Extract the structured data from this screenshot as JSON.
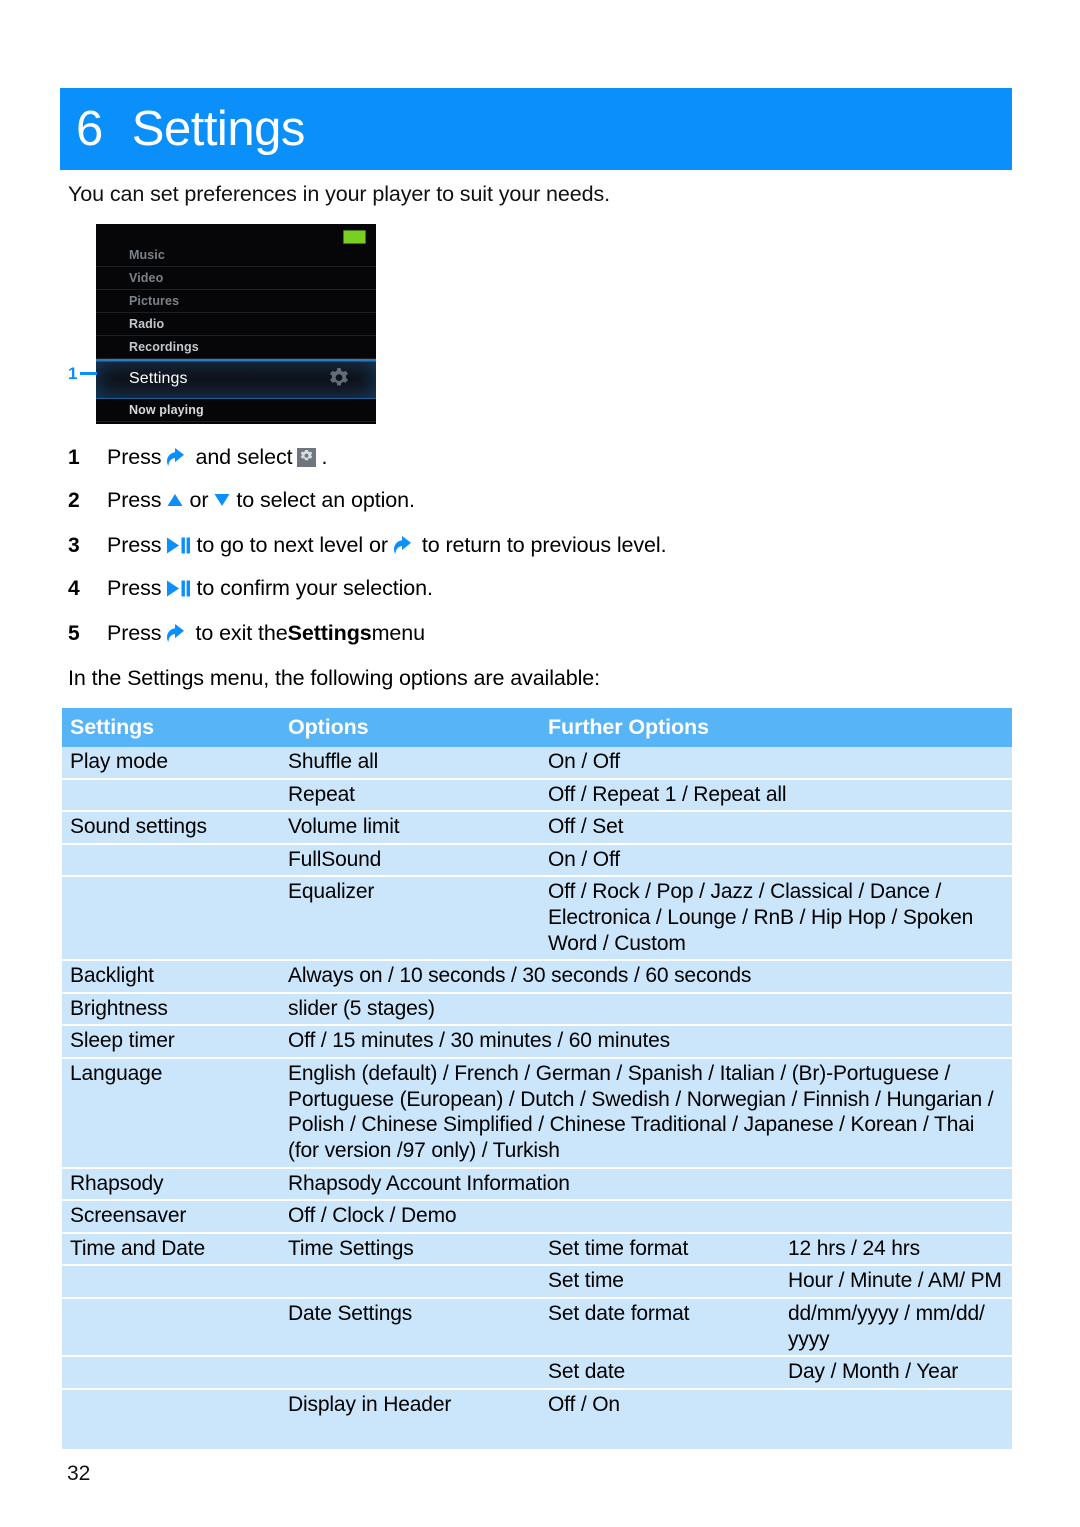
{
  "chapter": {
    "number": "6",
    "title": "Settings"
  },
  "intro": "You can set preferences in your player to suit your needs.",
  "device": {
    "callout_number": "1",
    "menu_items": [
      {
        "label": "Music"
      },
      {
        "label": "Video"
      },
      {
        "label": "Pictures"
      },
      {
        "label": "Radio"
      },
      {
        "label": "Recordings"
      },
      {
        "label": "Settings"
      },
      {
        "label": "Now playing"
      }
    ],
    "selected_item": "Settings",
    "selected_icon": "gear-icon",
    "battery_icon": "battery-full-icon"
  },
  "steps": [
    {
      "number": "1",
      "parts": [
        {
          "type": "text",
          "value": "Press "
        },
        {
          "type": "icon",
          "value": "back-arrow-icon"
        },
        {
          "type": "text",
          "value": " and select "
        },
        {
          "type": "icon",
          "value": "gear-square-icon"
        },
        {
          "type": "text",
          "value": "."
        }
      ],
      "plain": "Press [back] and select [settings]."
    },
    {
      "number": "2",
      "parts": [
        {
          "type": "text",
          "value": "Press "
        },
        {
          "type": "icon",
          "value": "triangle-up-icon"
        },
        {
          "type": "text",
          "value": " or "
        },
        {
          "type": "icon",
          "value": "triangle-down-icon"
        },
        {
          "type": "text",
          "value": " to select an option."
        }
      ],
      "plain": "Press [up] or [down] to select an option."
    },
    {
      "number": "3",
      "parts": [
        {
          "type": "text",
          "value": "Press "
        },
        {
          "type": "icon",
          "value": "play-pause-icon"
        },
        {
          "type": "text",
          "value": " to go to next level or "
        },
        {
          "type": "icon",
          "value": "back-arrow-icon"
        },
        {
          "type": "text",
          "value": " to return to previous level."
        }
      ],
      "plain": "Press [play/pause] to go to next level or [back] to return to previous level."
    },
    {
      "number": "4",
      "parts": [
        {
          "type": "text",
          "value": "Press "
        },
        {
          "type": "icon",
          "value": "play-pause-icon"
        },
        {
          "type": "text",
          "value": " to confirm your selection."
        }
      ],
      "plain": "Press [play/pause] to confirm your selection."
    },
    {
      "number": "5",
      "parts": [
        {
          "type": "text",
          "value": "Press "
        },
        {
          "type": "icon",
          "value": "back-arrow-icon"
        },
        {
          "type": "text",
          "value": " to exit the "
        },
        {
          "type": "bold",
          "value": "Settings"
        },
        {
          "type": "text",
          "value": " menu"
        }
      ],
      "plain": "Press [back] to exit the Settings menu"
    }
  ],
  "availability_text": "In the Settings menu, the following options are available:",
  "table": {
    "headers": [
      "Settings",
      "Options",
      "Further Options"
    ],
    "rows": [
      {
        "c1": "Play mode",
        "c2": "Shuffle all",
        "c3": "On / Off",
        "c4": ""
      },
      {
        "c1": "",
        "c2": "Repeat",
        "c3": "Off / Repeat 1 / Repeat all",
        "c4": ""
      },
      {
        "c1": "Sound settings",
        "c2": "Volume limit",
        "c3": "Off / Set",
        "c4": ""
      },
      {
        "c1": "",
        "c2": "FullSound",
        "c3": "On / Off",
        "c4": ""
      },
      {
        "c1": "",
        "c2": "Equalizer",
        "c3": "Off / Rock / Pop / Jazz / Classical / Dance / Electronica / Lounge / RnB / Hip Hop / Spoken Word / Custom",
        "c4": ""
      },
      {
        "c1": "Backlight",
        "c2": "Always on / 10 seconds / 30 seconds / 60 seconds",
        "c3": "",
        "c4": "",
        "span2": true
      },
      {
        "c1": "Brightness",
        "c2": "slider (5 stages)",
        "c3": "",
        "c4": "",
        "span2": true
      },
      {
        "c1": "Sleep timer",
        "c2": "Off / 15 minutes / 30 minutes / 60 minutes",
        "c3": "",
        "c4": "",
        "span2": true
      },
      {
        "c1": "Language",
        "c2": "English (default) / French / German / Spanish / Italian / (Br)-Portuguese / Portuguese (European) / Dutch / Swedish / Norwegian / Finnish / Hungarian / Polish / Chinese Simplified / Chinese Traditional / Japanese / Korean / Thai (for version /97 only) / Turkish",
        "c3": "",
        "c4": "",
        "span2": true
      },
      {
        "c1": "Rhapsody",
        "c2": "Rhapsody Account Information",
        "c3": "",
        "c4": "",
        "span2": true
      },
      {
        "c1": "Screensaver",
        "c2": "Off / Clock / Demo",
        "c3": "",
        "c4": "",
        "span2": true
      },
      {
        "c1": "Time and Date",
        "c2": "Time Settings",
        "c3": "Set time format",
        "c4": "12 hrs / 24 hrs"
      },
      {
        "c1": "",
        "c2": "",
        "c3": "Set time",
        "c4": "Hour / Minute / AM/ PM"
      },
      {
        "c1": "",
        "c2": "Date Settings",
        "c3": "Set date format",
        "c4": "dd/mm/yyyy / mm/dd/ yyyy"
      },
      {
        "c1": "",
        "c2": "",
        "c3": "Set date",
        "c4": "Day / Month / Year"
      },
      {
        "c1": "",
        "c2": "Display in Header",
        "c3": "Off / On",
        "c4": ""
      }
    ]
  },
  "page_number": "32",
  "colors": {
    "accent_blue": "#0a8ffb",
    "table_header_blue": "#56b4f7",
    "table_row_blue": "#cbe5fa",
    "battery_green": "#79d022"
  }
}
